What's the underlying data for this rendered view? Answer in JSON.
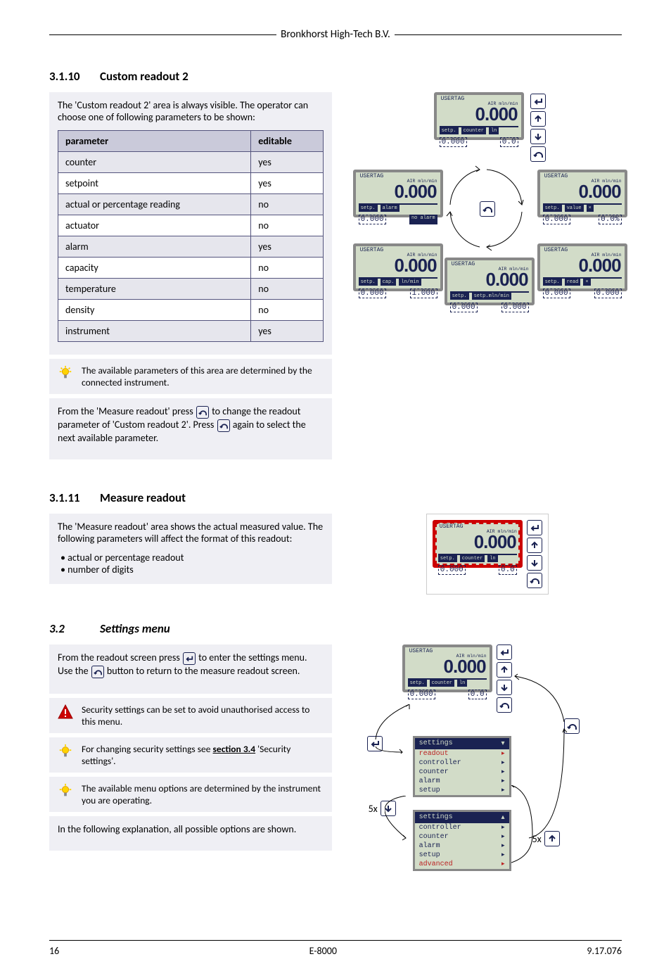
{
  "header": {
    "company": "Bronkhorst High-Tech B.V."
  },
  "s310": {
    "num": "3.1.10",
    "title": "Custom readout 2",
    "intro": "The 'Custom readout 2' area is always visible. The operator can choose one of following parameters to be shown:",
    "th1": "parameter",
    "th2": "editable",
    "rows": [
      {
        "p": "counter",
        "e": "yes"
      },
      {
        "p": "setpoint",
        "e": "yes"
      },
      {
        "p": "actual or percentage reading",
        "e": "no"
      },
      {
        "p": "actuator",
        "e": "no"
      },
      {
        "p": "alarm",
        "e": "yes"
      },
      {
        "p": "capacity",
        "e": "no"
      },
      {
        "p": "temperature",
        "e": "no"
      },
      {
        "p": "density",
        "e": "no"
      },
      {
        "p": "instrument",
        "e": "yes"
      }
    ],
    "tip": "The available parameters of this area are determined by the connected instrument.",
    "instr1a": "From the 'Measure readout' press ",
    "instr1b": " to change the readout parameter of 'Custom readout 2'. Press ",
    "instr1c": " again to select the next available parameter.",
    "lcd": {
      "usertag": "USERTAG",
      "unit": "AIR mln/min",
      "big": "0.000",
      "setp": "setp.",
      "counter": "counter",
      "ln": "ln",
      "v1": "0.000",
      "v2": "0.0",
      "alarm": "alarm",
      "noalarm": "no alarm",
      "cap": "cap.",
      "lnmin": "ln/min",
      "cap_v": "1.000",
      "value": "value",
      "pct": "0.0%",
      "read": "read",
      "read_v": "0.000",
      "bottom1": "setp.mln/min",
      "bottom_v1": "0.000",
      "bottom_v2": "0.000"
    }
  },
  "s311": {
    "num": "3.1.11",
    "title": "Measure readout",
    "p1": "The 'Measure readout' area shows the actual measured value. The following parameters will affect the format of this readout:",
    "b1": "actual or percentage readout",
    "b2": "number of digits"
  },
  "s32": {
    "num": "3.2",
    "title": "Settings menu",
    "p1a": "From the readout screen press ",
    "p1b": " to enter the settings menu. Use the ",
    "p1c": " button to return to the measure readout screen.",
    "warn": "Security settings can be set to avoid unauthorised access to this menu.",
    "tip1a": "For changing security settings see ",
    "tip1link": "section 3.4",
    "tip1b": " 'Security settings'.",
    "tip2": "The available menu options are determined by the instrument you are operating.",
    "p2": "In the following explanation, all possible options are shown.",
    "menu": {
      "header": "settings",
      "items1": [
        "readout",
        "controller",
        "counter",
        "alarm",
        "setup"
      ],
      "items2": [
        "controller",
        "counter",
        "alarm",
        "setup",
        "advanced"
      ],
      "five_x": "5x"
    }
  },
  "footer": {
    "page": "16",
    "center": "E-8000",
    "right": "9.17.076"
  }
}
